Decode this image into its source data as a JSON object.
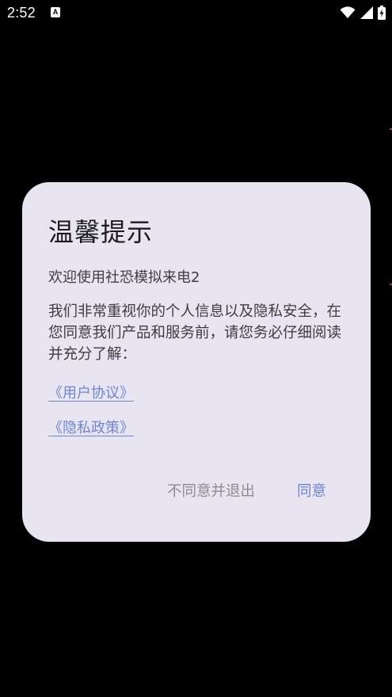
{
  "status_bar": {
    "time": "2:52",
    "notification_icon": "a-icon",
    "wifi_icon": "wifi-icon",
    "signal_icon": "signal-icon",
    "battery_icon": "battery-charging-icon"
  },
  "dialog": {
    "title": "温馨提示",
    "welcome": "欢迎使用社恐模拟来电2",
    "body": "我们非常重视你的个人信息以及隐私安全，在您同意我们产品和服务前，请您务必仔细阅读并充分了解：",
    "user_agreement_link": "《用户协议》",
    "privacy_policy_link": "《隐私政策》",
    "decline_button": "不同意并退出",
    "agree_button": "同意"
  },
  "colors": {
    "background": "#000000",
    "dialog_background": "#e9e5f0",
    "link": "#6b86d6",
    "decline_text": "#8e8c92",
    "body_text": "#3f3c44"
  }
}
